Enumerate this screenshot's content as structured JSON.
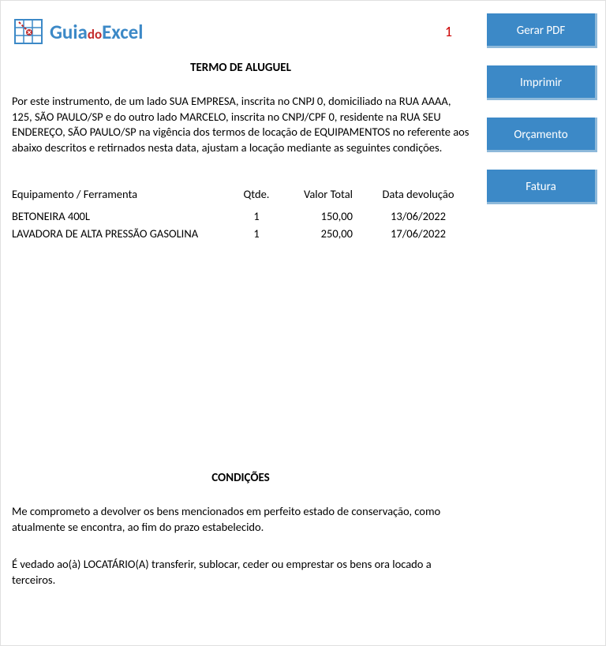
{
  "logo": {
    "part1": "Guia",
    "part2": "do",
    "part3": "Excel"
  },
  "pageNumber": "1",
  "title": "TERMO DE ALUGUEL",
  "intro": "Por este instrumento, de um lado SUA EMPRESA, inscrita no CNPJ 0, domiciliado na RUA AAAA, 125, SÃO PAULO/SP e do outro lado MARCELO, inscrita no CNPJ/CPF 0, residente na RUA SEU ENDEREÇO, SÃO PAULO/SP na vigência dos termos de locação de EQUIPAMENTOS no referente aos abaixo descritos e retirnados nesta data, ajustam a locação mediante as seguintes condições.",
  "table": {
    "headers": {
      "equip": "Equipamento / Ferramenta",
      "qty": "Qtde.",
      "val": "Valor Total",
      "date": "Data devolução"
    },
    "rows": [
      {
        "equip": "BETONEIRA 400L",
        "qty": "1",
        "val": "150,00",
        "date": "13/06/2022"
      },
      {
        "equip": "LAVADORA DE ALTA PRESSÃO GASOLINA",
        "qty": "1",
        "val": "250,00",
        "date": "17/06/2022"
      }
    ]
  },
  "conditionsTitle": "CONDIÇÕES",
  "conditions": [
    "Me comprometo a devolver os bens mencionados em perfeito estado de conservação, como atualmente se encontra, ao fim do prazo estabelecido.",
    "É vedado ao(à) LOCATÁRIO(A) transferir, sublocar, ceder ou emprestar os bens ora locado a terceiros."
  ],
  "buttons": {
    "pdf": "Gerar PDF",
    "print": "Imprimir",
    "budget": "Orçamento",
    "invoice": "Fatura"
  }
}
